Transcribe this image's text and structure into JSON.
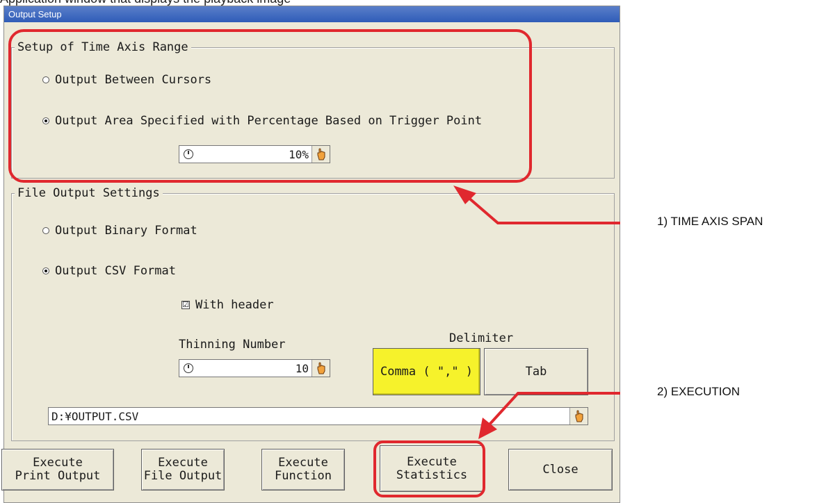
{
  "page": {
    "top_text": "Application window that displays the playback image"
  },
  "window": {
    "title": "Output Setup"
  },
  "time_axis": {
    "legend": "Setup of Time Axis Range",
    "option_between": "Output Between Cursors",
    "option_percentage": "Output Area Specified with Percentage Based on Trigger Point",
    "selected": "percentage",
    "percentage_value": "10%"
  },
  "file_output": {
    "legend": "File Output Settings",
    "option_binary": "Output Binary Format",
    "option_csv": "Output CSV Format",
    "selected": "csv",
    "with_header_label": "With header",
    "with_header_checked": true,
    "check_glyph": "☑",
    "thinning_label": "Thinning Number",
    "thinning_value": "10",
    "delimiter_label": "Delimiter",
    "delimiter_comma": "Comma ( \",\" )",
    "delimiter_tab": "Tab",
    "delimiter_selected": "comma",
    "path_value": "D:¥OUTPUT.CSV"
  },
  "buttons": {
    "print_output": "Execute\nPrint Output",
    "file_output": "Execute\nFile Output",
    "function": "Execute\nFunction",
    "statistics": "Execute\nStatistics",
    "close": "Close"
  },
  "callouts": {
    "time_axis_span": "1) TIME AXIS SPAN",
    "execution": "2) EXECUTION"
  },
  "colors": {
    "highlight": "#e0282e",
    "selected_delimiter": "#f6f22b",
    "dialog_bg": "#ece9d8",
    "titlebar": "#2f5cb8"
  }
}
